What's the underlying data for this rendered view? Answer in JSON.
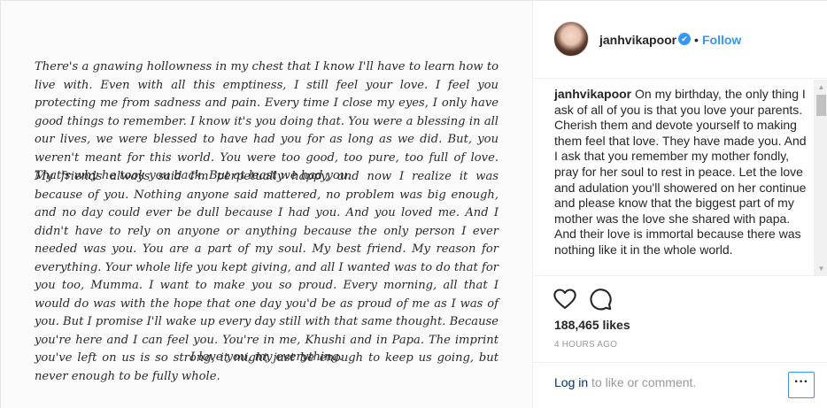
{
  "post_image": {
    "paragraph1": "There's a gnawing hollowness in my chest that I know I'll have to learn how to live with. Even with all this emptiness, I still feel your love. I feel you protecting me from sadness and pain. Every time I close my eyes, I only have good things to remember. I know it's you doing that. You were a blessing in all our lives, we were blessed to have had you for as long as we did. But, you weren't meant for this world. You were too good, too pure, too full of love. That's why he took you back. But at least we had you.",
    "paragraph2": "My friends always said I'm perpetually happy, and now I realize it was because of you. Nothing anyone said mattered, no problem was big enough, and no day could ever be dull because I had you. And you loved me. And I didn't have to rely on anyone or anything because the only person I ever needed was you. You are a part of my soul. My best friend. My reason for everything. Your whole life you kept giving, and all I wanted was to do that for you too, Mumma. I want to make you so proud. Every morning, all that I would do was with the hope that one day you'd be as proud of me as I was of you. But I promise I'll wake up every day still with that same thought. Because you're here and I can feel you. You're in me, Khushi and in Papa. The imprint you've left on us is so strong, it might just be enough to keep us going, but never enough to be fully whole.",
    "signoff": "I love you, my everything."
  },
  "header": {
    "username": "janhvikapoor",
    "verified_glyph": "✔",
    "separator": "•",
    "follow_label": "Follow"
  },
  "caption": {
    "username": "janhvikapoor",
    "text": "On my birthday, the only thing I ask of all of you is that you love your parents. Cherish them and devote yourself to making them feel that love. They have made you. And I ask that you remember my mother fondly, pray for her soul to rest in peace. Let the love and adulation you'll showered on her continue and please know that the biggest part of my mother was the love she shared with papa. And their love is immortal because there was nothing like it in the whole world."
  },
  "scrollbar": {
    "up_glyph": "▲",
    "down_glyph": "▼"
  },
  "actions": {
    "likes": "188,465 likes",
    "time": "4 HOURS AGO"
  },
  "footer": {
    "login_label": "Log in",
    "login_suffix": " to like or comment.",
    "more_label": "···"
  },
  "colors": {
    "link_blue": "#3897f0",
    "text": "#262626",
    "muted": "#999999",
    "border": "#efefef"
  }
}
